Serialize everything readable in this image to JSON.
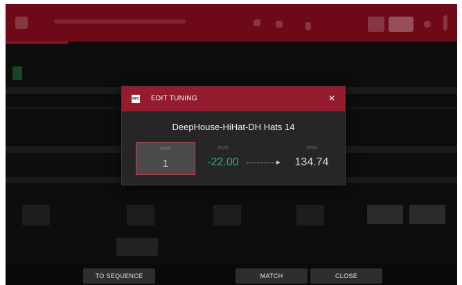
{
  "modal": {
    "logo": "MPC",
    "title": "EDIT TUNING",
    "close_icon": "×",
    "sample_name": "DeepHouse-HiHat-DH Hats 14",
    "semi": {
      "label": "SEMI",
      "value": "1"
    },
    "time": {
      "label": "TIME",
      "value": "-22.00"
    },
    "bpm": {
      "label": "BPM",
      "value": "134.74"
    }
  },
  "footer": {
    "to_sequence": "TO SEQUENCE",
    "match": "MATCH",
    "close": "CLOSE"
  }
}
